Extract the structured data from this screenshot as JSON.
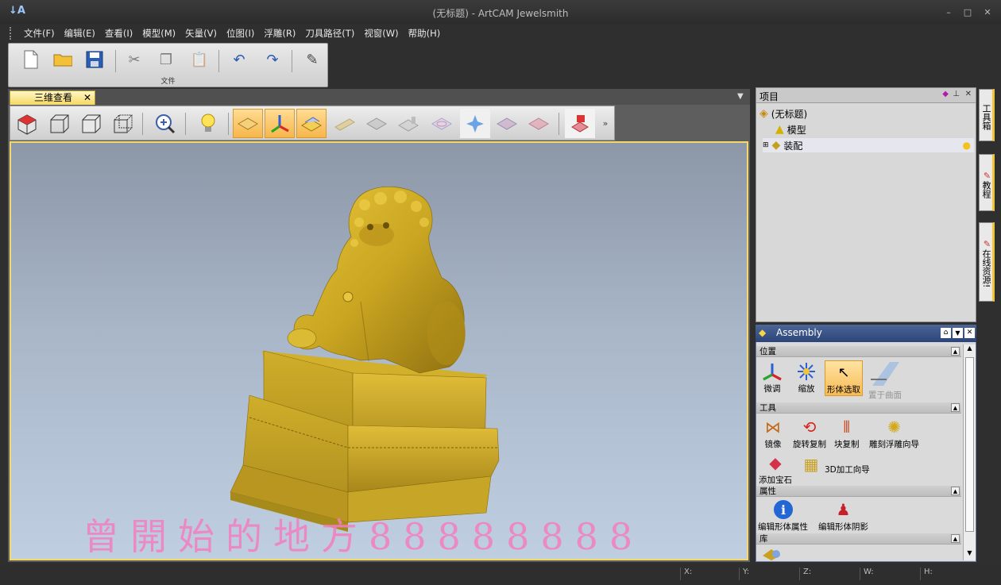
{
  "window": {
    "title": "(无标题) - ArtCAM Jewelsmith",
    "min": "–",
    "max": "□",
    "close": "✕"
  },
  "menu": [
    {
      "label": "文件(F)"
    },
    {
      "label": "编辑(E)"
    },
    {
      "label": "查看(I)"
    },
    {
      "label": "模型(M)"
    },
    {
      "label": "矢量(V)"
    },
    {
      "label": "位图(I)"
    },
    {
      "label": "浮雕(R)"
    },
    {
      "label": "刀具路径(T)"
    },
    {
      "label": "视窗(W)"
    },
    {
      "label": "帮助(H)"
    }
  ],
  "file_toolbar": {
    "caption": "文件"
  },
  "view_tab": {
    "label": "三维查看",
    "close": "✕"
  },
  "project": {
    "title": "项目",
    "root": "(无标题)",
    "children": [
      "模型",
      "装配"
    ]
  },
  "assembly": {
    "title": "Assembly",
    "sections": {
      "position": {
        "title": "位置",
        "tools": [
          "微调",
          "缩放",
          "形体选取",
          "置于曲面"
        ]
      },
      "tools": {
        "title": "工具",
        "tools": [
          "镜像",
          "旋转复制",
          "块复制",
          "雕刻浮雕向导",
          "添加宝石",
          "3D加工向导"
        ]
      },
      "properties": {
        "title": "属性",
        "tools": [
          "编辑形体属性",
          "编辑形体阴影"
        ]
      },
      "library": {
        "title": "库"
      }
    }
  },
  "side_tabs": [
    "工具箱",
    "教程",
    "在线资源!"
  ],
  "status": {
    "x": "X:",
    "y": "Y:",
    "z": "Z:",
    "w": "W:",
    "h": "H:"
  },
  "watermark": "曾開始的地方88888888",
  "colors": {
    "accent": "#f5d865",
    "model_gold": "#c9a521",
    "assembly_header": "#2c4477"
  }
}
